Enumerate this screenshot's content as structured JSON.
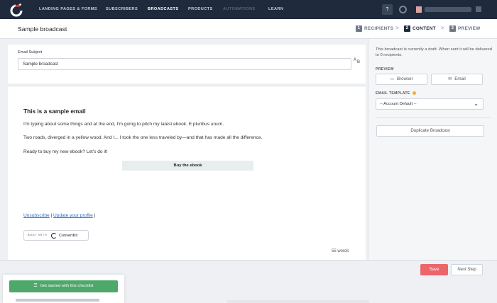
{
  "colors": {
    "nav_bg": "#1f2b3d",
    "save": "#ec6569",
    "checklist": "#4da86a",
    "link": "#2a6fd3",
    "template_dot": "#f0ad3c"
  },
  "nav": {
    "items": [
      "LANDING PAGES & FORMS",
      "SUBSCRIBERS",
      "BROADCASTS",
      "PRODUCTS",
      "AUTOMATIONS",
      "LEARN"
    ],
    "active": "BROADCASTS",
    "help_label": "?"
  },
  "header": {
    "title": "Sample broadcast",
    "steps": [
      {
        "num": "1",
        "label": "RECIPIENTS"
      },
      {
        "num": "2",
        "label": "CONTENT"
      },
      {
        "num": "3",
        "label": "PREVIEW"
      }
    ],
    "separator": ">"
  },
  "subject": {
    "label": "Email Subject",
    "value": "Sample broadcast",
    "icon": "ab-test-icon",
    "ab_a": "A",
    "ab_b": "B"
  },
  "email": {
    "heading": "This is a sample email",
    "paragraphs": [
      "I'm typing about some things and at the end, I'm going to pitch my latest ebook. E pluribus unum.",
      "Two roads, diverged in a yellow wood. And I... I took the one less traveled by—and that has made all the difference.",
      "Ready to buy my new ebook? Let's do it!"
    ],
    "cta": "Buy the ebook",
    "unsubscribe": "Unsubscribe",
    "update_profile": "Update your profile",
    "built_with": "BUILT WITH",
    "brand": "ConvertKit",
    "word_count": "55 words"
  },
  "panel": {
    "draft_note": "This broadcast is currently a draft. When sent it will be delivered to 0 recipients.",
    "preview_label": "PREVIEW",
    "browser_btn": "Browser",
    "email_btn": "Email",
    "template_label": "EMAIL TEMPLATE",
    "template_value": "-- Account Default --",
    "duplicate_btn": "Duplicate Broadcast"
  },
  "footer": {
    "save": "Save",
    "next": "Next Step",
    "checklist": "Get started with this checklist"
  }
}
